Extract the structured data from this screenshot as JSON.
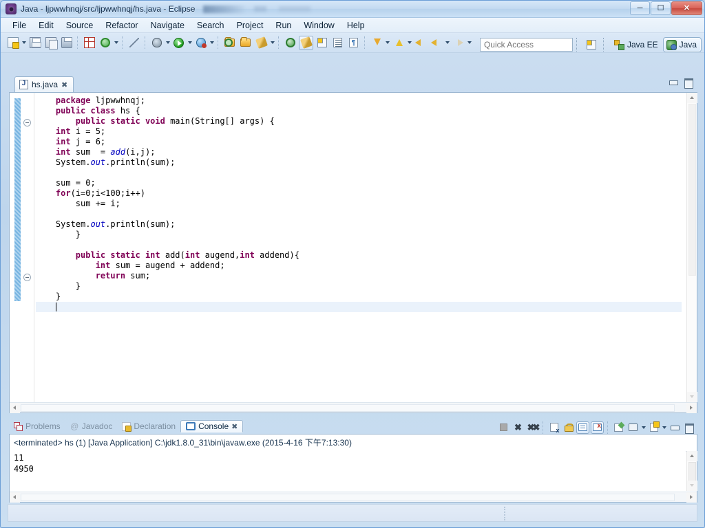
{
  "window": {
    "title": "Java - ljpwwhnqj/src/ljpwwhnqj/hs.java - Eclipse",
    "icon": "eclipse-icon",
    "controls": {
      "minimize": "–",
      "restore": "❐",
      "close": "✕"
    }
  },
  "menubar": {
    "items": [
      {
        "label": "File"
      },
      {
        "label": "Edit"
      },
      {
        "label": "Source"
      },
      {
        "label": "Refactor"
      },
      {
        "label": "Navigate"
      },
      {
        "label": "Search"
      },
      {
        "label": "Project"
      },
      {
        "label": "Run"
      },
      {
        "label": "Window"
      },
      {
        "label": "Help"
      }
    ]
  },
  "toolbar": {
    "icons": [
      "new-wizard-icon",
      "save-icon",
      "save-all-icon",
      "print-icon",
      "toggle-grid-icon",
      "refresh-icon",
      "toggle-mark-occurrences-icon",
      "debug-icon",
      "run-icon",
      "coverage-icon",
      "new-java-project-icon",
      "open-type-icon",
      "search-icon",
      "next-edit-location-icon",
      "open-perspective-icon",
      "java-perspective-icon",
      "java-browsing-icon",
      "outline-icon",
      "show-whitespace-icon",
      "next-annotation-icon",
      "previous-annotation-icon",
      "back-icon",
      "forward-icon"
    ]
  },
  "quick_access": {
    "placeholder": "Quick Access",
    "value": "",
    "open_perspective_icon": "open-perspective-icon",
    "perspectives": [
      {
        "label": "Java EE",
        "icon": "java-ee-perspective-icon",
        "active": false
      },
      {
        "label": "Java",
        "icon": "java-perspective-icon",
        "active": true
      }
    ]
  },
  "editor": {
    "tab": {
      "label": "hs.java",
      "icon": "java-file-icon",
      "close": "✖",
      "active": true
    },
    "minimize_label": "Minimize",
    "maximize_label": "Maximize",
    "code_lines": [
      {
        "indent": 4,
        "tokens": [
          {
            "t": "package ",
            "c": "kw"
          },
          {
            "t": "ljpwwhnqj;",
            "c": ""
          }
        ]
      },
      {
        "indent": 4,
        "tokens": [
          {
            "t": "public class ",
            "c": "kw"
          },
          {
            "t": "hs {",
            "c": ""
          }
        ]
      },
      {
        "indent": 8,
        "tokens": [
          {
            "t": "public static void ",
            "c": "kw"
          },
          {
            "t": "main(String[] args) {",
            "c": ""
          }
        ]
      },
      {
        "indent": 4,
        "tokens": [
          {
            "t": "int ",
            "c": "kw"
          },
          {
            "t": "i = 5;",
            "c": ""
          }
        ]
      },
      {
        "indent": 4,
        "tokens": [
          {
            "t": "int ",
            "c": "kw"
          },
          {
            "t": "j = 6;",
            "c": ""
          }
        ]
      },
      {
        "indent": 4,
        "tokens": [
          {
            "t": "int ",
            "c": "kw"
          },
          {
            "t": "sum  = ",
            "c": ""
          },
          {
            "t": "add",
            "c": "it"
          },
          {
            "t": "(i,j);",
            "c": ""
          }
        ]
      },
      {
        "indent": 4,
        "tokens": [
          {
            "t": "System.",
            "c": ""
          },
          {
            "t": "out",
            "c": "it"
          },
          {
            "t": ".println(sum);",
            "c": ""
          }
        ]
      },
      {
        "indent": 0,
        "tokens": []
      },
      {
        "indent": 4,
        "tokens": [
          {
            "t": "sum = 0;",
            "c": ""
          }
        ]
      },
      {
        "indent": 4,
        "tokens": [
          {
            "t": "for",
            "c": "kw"
          },
          {
            "t": "(i=0;i<100;i++)",
            "c": ""
          }
        ]
      },
      {
        "indent": 8,
        "tokens": [
          {
            "t": "sum += i;",
            "c": ""
          }
        ]
      },
      {
        "indent": 0,
        "tokens": []
      },
      {
        "indent": 4,
        "tokens": [
          {
            "t": "System.",
            "c": ""
          },
          {
            "t": "out",
            "c": "it"
          },
          {
            "t": ".println(sum);",
            "c": ""
          }
        ]
      },
      {
        "indent": 8,
        "tokens": [
          {
            "t": "}",
            "c": ""
          }
        ]
      },
      {
        "indent": 0,
        "tokens": []
      },
      {
        "indent": 8,
        "tokens": [
          {
            "t": "public static int ",
            "c": "kw"
          },
          {
            "t": "add(",
            "c": ""
          },
          {
            "t": "int ",
            "c": "kw"
          },
          {
            "t": "augend,",
            "c": ""
          },
          {
            "t": "int ",
            "c": "kw"
          },
          {
            "t": "addend){",
            "c": ""
          }
        ]
      },
      {
        "indent": 12,
        "tokens": [
          {
            "t": "int ",
            "c": "kw"
          },
          {
            "t": "sum = augend + addend;",
            "c": ""
          }
        ]
      },
      {
        "indent": 12,
        "tokens": [
          {
            "t": "return ",
            "c": "kw"
          },
          {
            "t": "sum;",
            "c": ""
          }
        ]
      },
      {
        "indent": 8,
        "tokens": [
          {
            "t": "}",
            "c": ""
          }
        ]
      },
      {
        "indent": 4,
        "tokens": [
          {
            "t": "}",
            "c": ""
          }
        ]
      },
      {
        "indent": 4,
        "tokens": []
      }
    ],
    "fold_markers": [
      "collapse-main-method",
      "collapse-add-method"
    ],
    "change_bar": "changed-lines-marker"
  },
  "bottom_panel": {
    "tabs": [
      {
        "label": "Problems",
        "icon": "problems-icon",
        "active": false
      },
      {
        "label": "Javadoc",
        "icon": "javadoc-icon",
        "active": false
      },
      {
        "label": "Declaration",
        "icon": "declaration-icon",
        "active": false
      },
      {
        "label": "Console",
        "icon": "console-icon",
        "active": true,
        "close": "✖"
      }
    ],
    "tools": [
      "terminate-icon",
      "remove-launch-icon",
      "remove-all-terminated-icon",
      "clear-console-icon",
      "scroll-lock-icon",
      "show-console-on-output-icon",
      "show-console-on-error-icon",
      "pin-console-icon",
      "display-selected-console-icon",
      "open-console-icon",
      "minimize-icon",
      "maximize-icon"
    ],
    "console": {
      "header": "<terminated> hs (1) [Java Application] C:\\jdk1.8.0_31\\bin\\javaw.exe (2015-4-16 下午7:13:30)",
      "output": "11\n4950"
    }
  },
  "statusbar": {
    "text": ""
  },
  "colors": {
    "keyword": "#7f0055",
    "italic_field": "#0000c0",
    "accent_blue": "#3b79b8",
    "changed_marker": "#5fa7dc",
    "cursor_line": "#eaf2fb",
    "window_chrome": "#cfe0f2"
  }
}
